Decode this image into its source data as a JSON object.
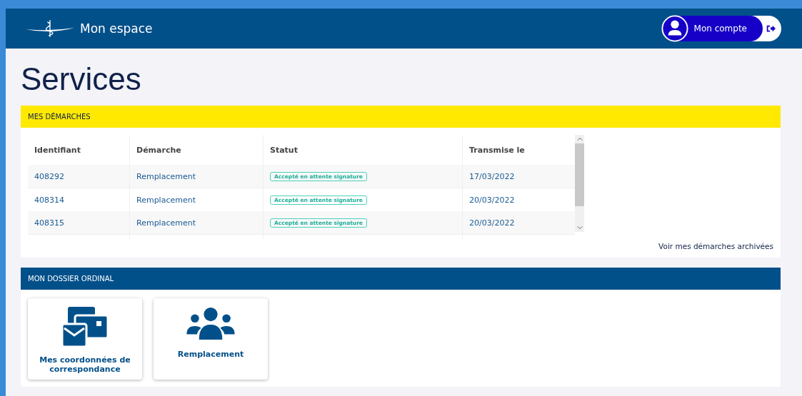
{
  "header": {
    "title": "Mon espace",
    "account_button": "Mon compte"
  },
  "page_title": "Services",
  "demarches": {
    "title": "MES DÉMARCHES",
    "columns": [
      "Identifiant",
      "Démarche",
      "Statut",
      "Transmise le"
    ],
    "rows": [
      {
        "id": "408292",
        "demarche": "Remplacement",
        "statut": "Accepté en attente signature",
        "date": "17/03/2022"
      },
      {
        "id": "408314",
        "demarche": "Remplacement",
        "statut": "Accepté en attente signature",
        "date": "20/03/2022"
      },
      {
        "id": "408315",
        "demarche": "Remplacement",
        "statut": "Accepté en attente signature",
        "date": "20/03/2022"
      }
    ],
    "archive_link": "Voir mes démarches archivées"
  },
  "dossier": {
    "title": "MON DOSSIER ORDINAL",
    "tiles": [
      {
        "kind": "mail",
        "label": "Mes coordonnées de correspondance"
      },
      {
        "kind": "people",
        "label": "Remplacement"
      }
    ]
  }
}
